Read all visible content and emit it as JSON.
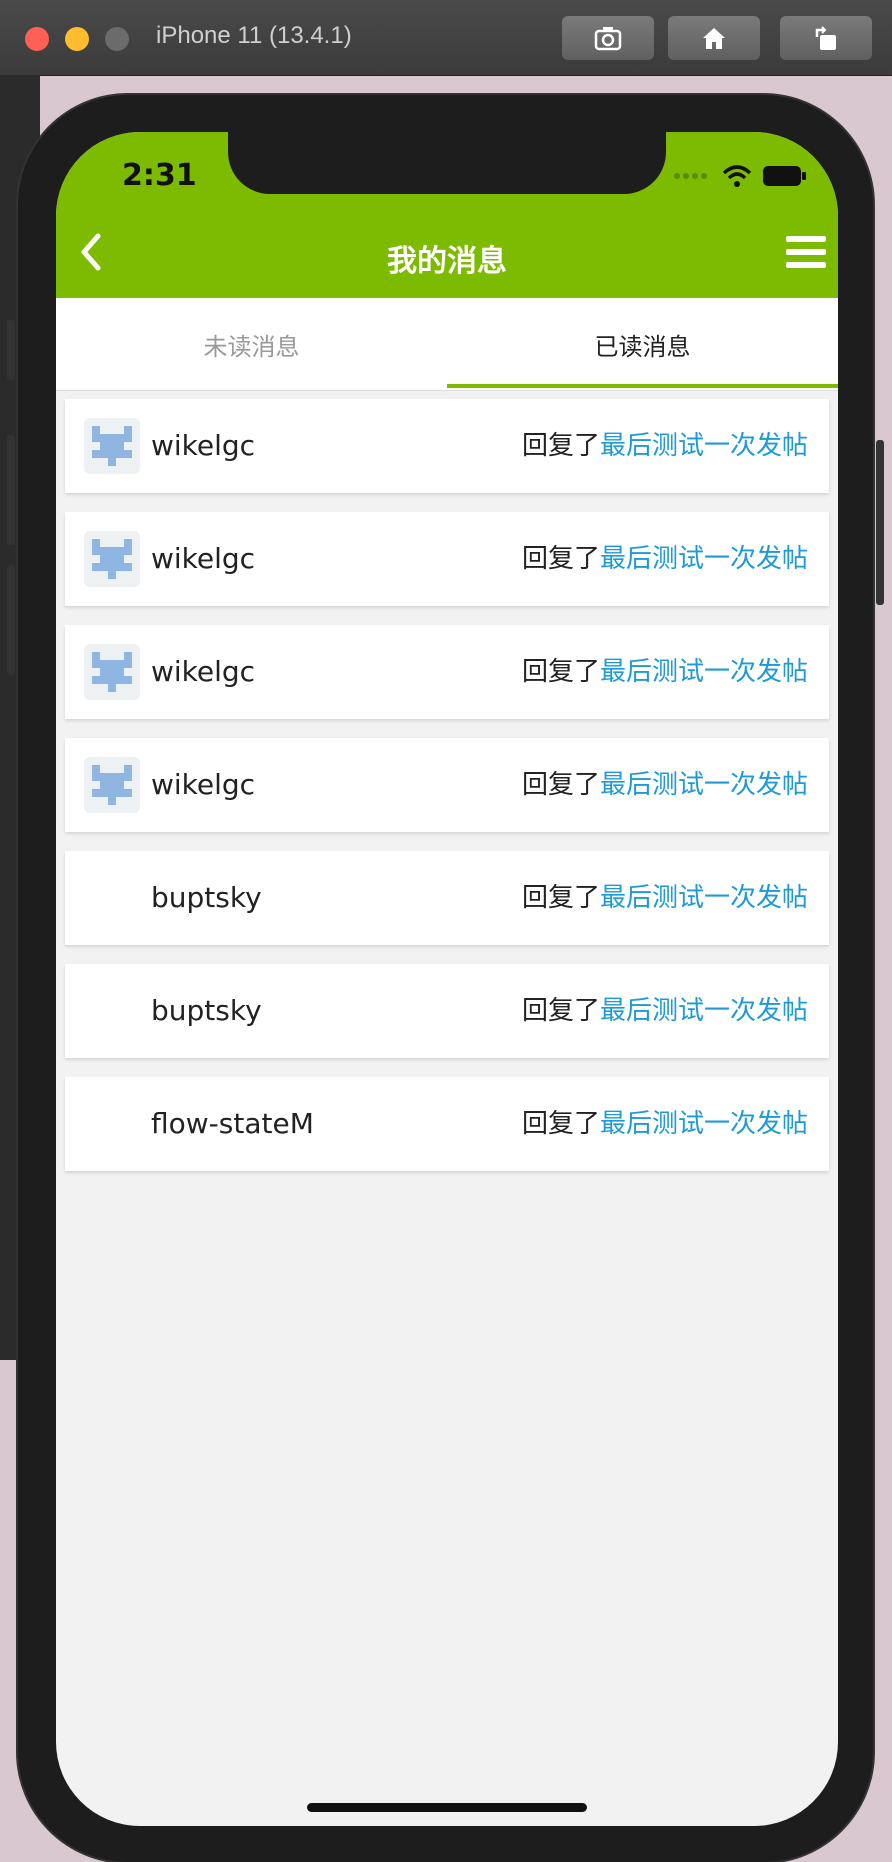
{
  "simulator": {
    "title": "iPhone 11 (13.4.1)",
    "buttons": [
      "screenshot-icon",
      "home-icon",
      "rotate-icon"
    ]
  },
  "status_bar": {
    "time": "2:31"
  },
  "nav": {
    "title": "我的消息",
    "back_icon": "chevron-left-icon",
    "menu_icon": "hamburger-menu-icon"
  },
  "tabs": [
    {
      "label": "未读消息",
      "active": false
    },
    {
      "label": "已读消息",
      "active": true
    }
  ],
  "colors": {
    "header": "#7dbb00",
    "link": "#1e9ad6",
    "background": "#f2f2f2"
  },
  "messages": [
    {
      "user": "wikelgc",
      "has_avatar": true,
      "action": "回复了",
      "topic": "最后测试一次发帖"
    },
    {
      "user": "wikelgc",
      "has_avatar": true,
      "action": "回复了",
      "topic": "最后测试一次发帖"
    },
    {
      "user": "wikelgc",
      "has_avatar": true,
      "action": "回复了",
      "topic": "最后测试一次发帖"
    },
    {
      "user": "wikelgc",
      "has_avatar": true,
      "action": "回复了",
      "topic": "最后测试一次发帖"
    },
    {
      "user": "buptsky",
      "has_avatar": false,
      "action": "回复了",
      "topic": "最后测试一次发帖"
    },
    {
      "user": "buptsky",
      "has_avatar": false,
      "action": "回复了",
      "topic": "最后测试一次发帖"
    },
    {
      "user": "flow-stateM",
      "has_avatar": false,
      "action": "回复了",
      "topic": "最后测试一次发帖"
    }
  ]
}
